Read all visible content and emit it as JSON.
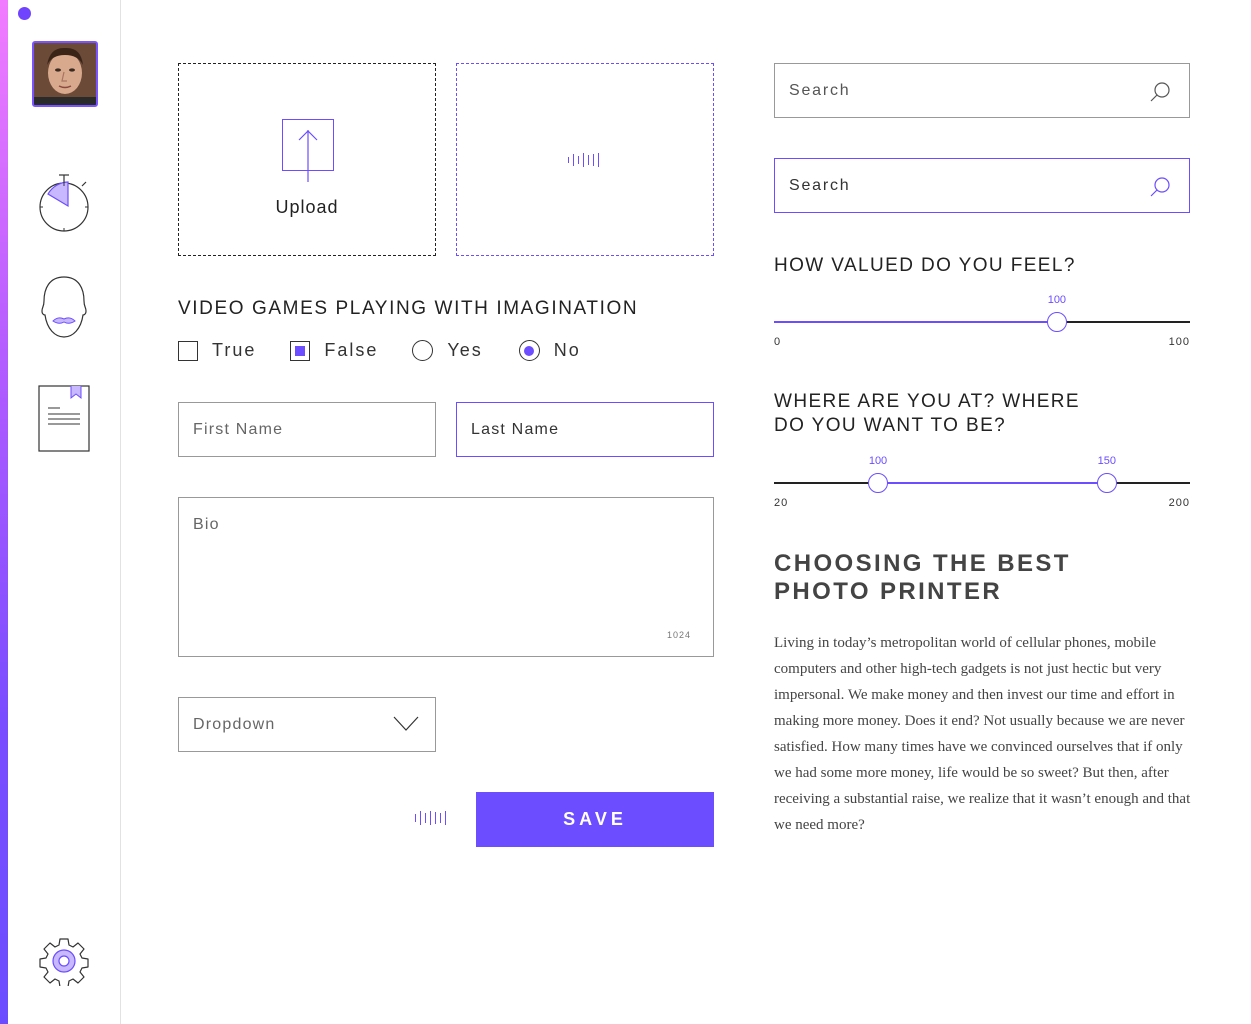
{
  "upload": {
    "label": "Upload"
  },
  "question_section": {
    "title": "VIDEO GAMES PLAYING WITH IMAGINATION",
    "options": [
      {
        "label": "True",
        "type": "checkbox",
        "checked": false
      },
      {
        "label": "False",
        "type": "checkbox",
        "checked": true
      },
      {
        "label": "Yes",
        "type": "radio",
        "checked": false
      },
      {
        "label": "No",
        "type": "radio",
        "checked": true
      }
    ]
  },
  "form": {
    "first_name_placeholder": "First Name",
    "last_name_placeholder": "Last Name",
    "bio_placeholder": "Bio",
    "bio_char_count": "1024",
    "dropdown_value": "Dropdown",
    "save_label": "SAVE"
  },
  "search": [
    {
      "placeholder": "Search",
      "state": "default"
    },
    {
      "placeholder": "Search",
      "state": "active"
    }
  ],
  "slider_single": {
    "title": "HOW VALUED DO YOU FEEL?",
    "min": "0",
    "max": "100",
    "value": "100",
    "value_fraction": 0.68
  },
  "slider_range": {
    "title_line1": "WHERE ARE YOU AT? WHERE",
    "title_line2": "DO YOU WANT TO BE?",
    "min": "20",
    "max": "200",
    "low": "100",
    "high": "150",
    "low_fraction": 0.25,
    "high_fraction": 0.8
  },
  "article": {
    "title_line1": "CHOOSING THE BEST",
    "title_line2": "PHOTO PRINTER",
    "body": "Living in today’s metropolitan world of cellular phones, mobile computers and other high-tech gadgets is not just hectic but very impersonal. We make money and then invest our time and effort in making more money. Does it end? Not usually because we are never satisfied. How many times have we convinced ourselves that if only we had some more money, life would be so sweet? But then, after receiving a substantial raise, we realize that it wasn’t enough and that we need more?"
  },
  "colors": {
    "accent": "#6c4dff",
    "text": "#222222",
    "border": "#999999"
  }
}
